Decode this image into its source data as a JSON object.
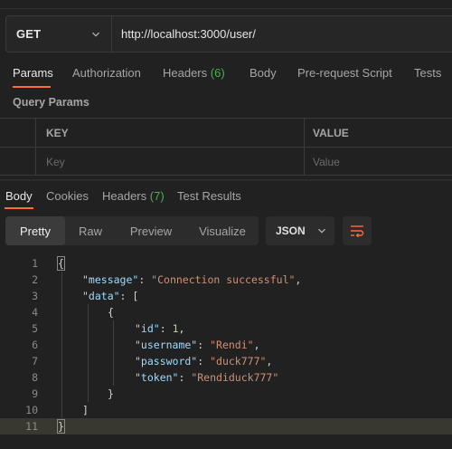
{
  "request": {
    "method": "GET",
    "url": "http://localhost:3000/user/"
  },
  "request_tabs": [
    {
      "label": "Params",
      "count": ""
    },
    {
      "label": "Authorization",
      "count": ""
    },
    {
      "label": "Headers",
      "count": "(6)"
    },
    {
      "label": "Body",
      "count": ""
    },
    {
      "label": "Pre-request Script",
      "count": ""
    },
    {
      "label": "Tests",
      "count": ""
    }
  ],
  "query_params": {
    "title": "Query Params",
    "key_header": "KEY",
    "value_header": "VALUE",
    "key_placeholder": "Key",
    "value_placeholder": "Value"
  },
  "response_tabs": [
    {
      "label": "Body",
      "count": ""
    },
    {
      "label": "Cookies",
      "count": ""
    },
    {
      "label": "Headers",
      "count": "(7)"
    },
    {
      "label": "Test Results",
      "count": ""
    }
  ],
  "view_modes": [
    "Pretty",
    "Raw",
    "Preview",
    "Visualize"
  ],
  "format": "JSON",
  "code_lines": {
    "numbers": [
      "1",
      "2",
      "3",
      "4",
      "5",
      "6",
      "7",
      "8",
      "9",
      "10",
      "11"
    ],
    "open_brace": "{",
    "close_brace": "}",
    "message_key": "\"message\"",
    "message_val": "\"Connection successful\"",
    "data_key": "\"data\"",
    "data_open": "[",
    "data_close": "]",
    "obj_open": "{",
    "obj_close": "}",
    "id_key": "\"id\"",
    "id_val": "1",
    "username_key": "\"username\"",
    "username_val": "\"Rendi\"",
    "password_key": "\"password\"",
    "password_val": "\"duck777\"",
    "token_key": "\"token\"",
    "token_val": "\"Rendiduck777\""
  },
  "colors": {
    "accent": "#ff6c37",
    "count_green": "#4caf50",
    "json_key": "#9cdcfe",
    "json_string": "#ce9178",
    "json_number": "#b5cea8"
  }
}
